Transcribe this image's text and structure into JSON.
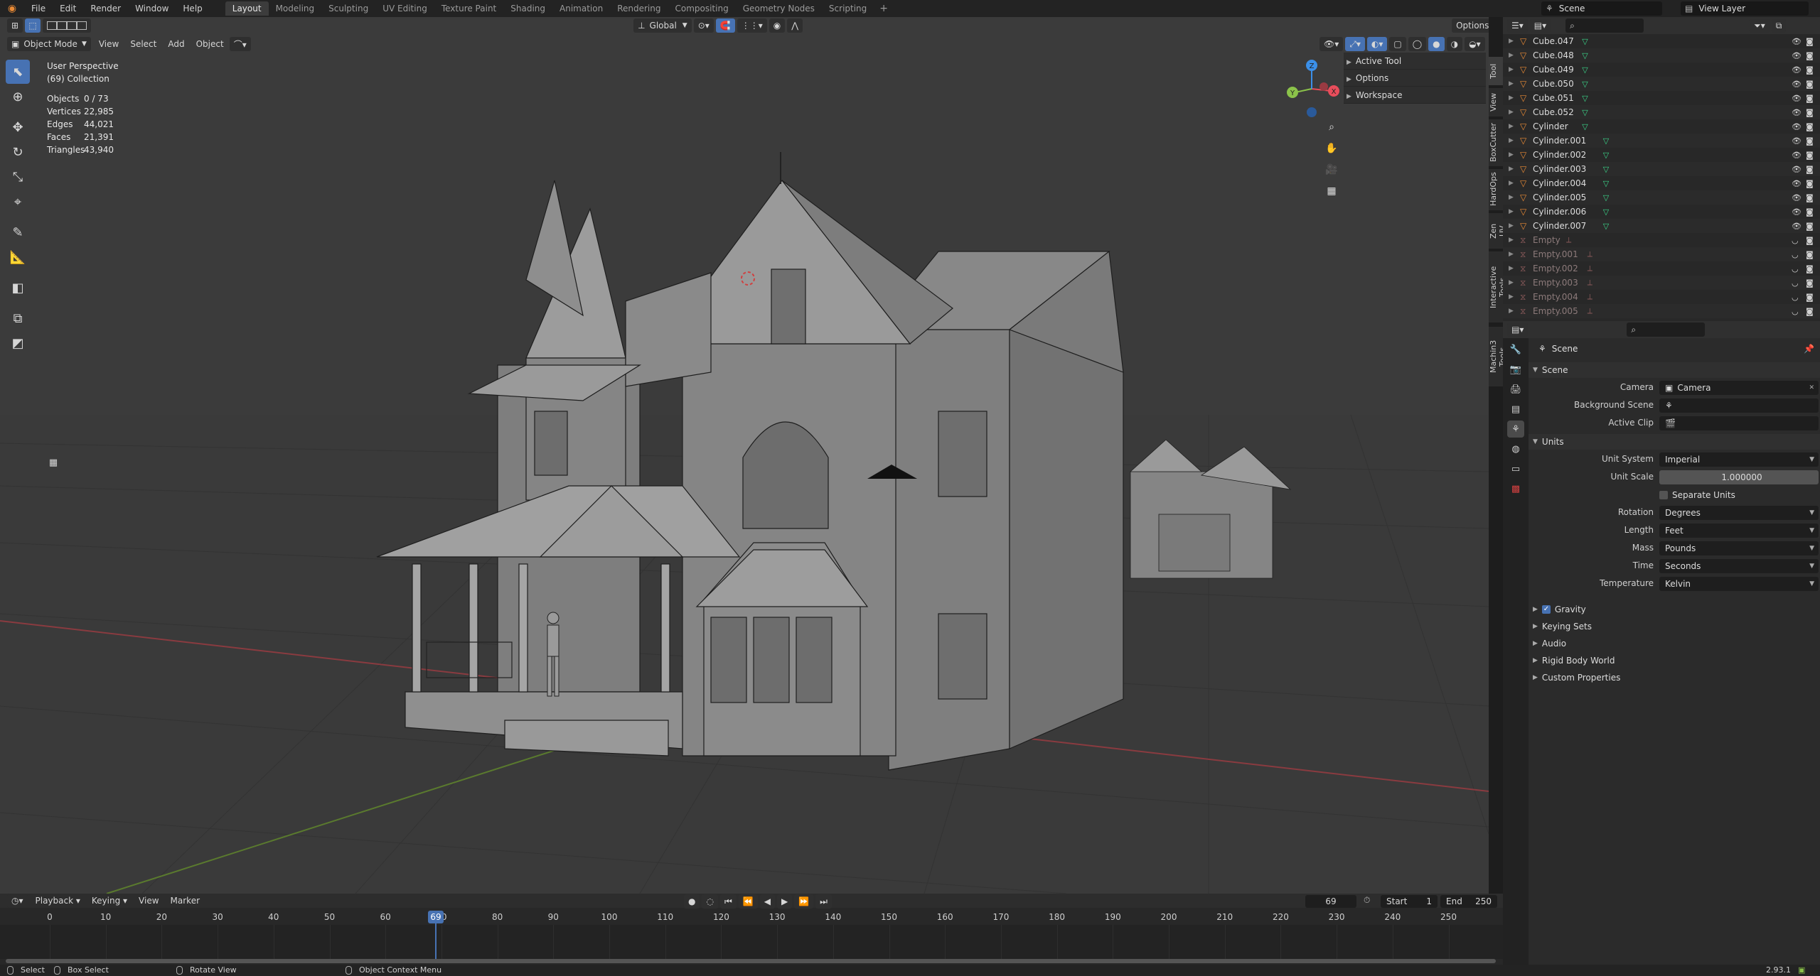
{
  "menubar": {
    "items": [
      "File",
      "Edit",
      "Render",
      "Window",
      "Help"
    ],
    "workspaces": [
      "Layout",
      "Modeling",
      "Sculpting",
      "UV Editing",
      "Texture Paint",
      "Shading",
      "Animation",
      "Rendering",
      "Compositing",
      "Geometry Nodes",
      "Scripting"
    ],
    "active_workspace": "Layout",
    "scene": "Scene",
    "view_layer": "View Layer"
  },
  "viewport_header": {
    "mode": "Object Mode",
    "menus": [
      "View",
      "Select",
      "Add",
      "Object"
    ],
    "transform_orientation": "Global",
    "options_label": "Options"
  },
  "viewport_info": {
    "perspective": "User Perspective",
    "collection": "(69) Collection",
    "stats": [
      {
        "label": "Objects",
        "value": "0 / 73"
      },
      {
        "label": "Vertices",
        "value": "22,985"
      },
      {
        "label": "Edges",
        "value": "44,021"
      },
      {
        "label": "Faces",
        "value": "21,391"
      },
      {
        "label": "Triangles",
        "value": "43,940"
      }
    ]
  },
  "npanel": {
    "items": [
      "Active Tool",
      "Options",
      "Workspace"
    ],
    "tabs": [
      "Tool",
      "View",
      "BoxCutter",
      "HardOps",
      "Zen UV",
      "Interactive Tools",
      "Machin3 Tools"
    ]
  },
  "gizmo": {
    "x": "X",
    "y": "Y",
    "z": "Z"
  },
  "timeline": {
    "menus": [
      "Playback",
      "Keying",
      "View",
      "Marker"
    ],
    "current_frame": "69",
    "start_label": "Start",
    "start": "1",
    "end_label": "End",
    "end": "250",
    "ticks": [
      "0",
      "10",
      "20",
      "30",
      "40",
      "50",
      "60",
      "70",
      "80",
      "90",
      "100",
      "110",
      "120",
      "130",
      "140",
      "150",
      "160",
      "170",
      "180",
      "190",
      "200",
      "210",
      "220",
      "230",
      "240",
      "250"
    ]
  },
  "statusbar": {
    "select": "Select",
    "box_select": "Box Select",
    "rotate_view": "Rotate View",
    "context_menu": "Object Context Menu",
    "version": "2.93.1"
  },
  "outliner": {
    "rows": [
      {
        "name": "Cube.047",
        "type": "mesh"
      },
      {
        "name": "Cube.048",
        "type": "mesh"
      },
      {
        "name": "Cube.049",
        "type": "mesh"
      },
      {
        "name": "Cube.050",
        "type": "mesh"
      },
      {
        "name": "Cube.051",
        "type": "mesh"
      },
      {
        "name": "Cube.052",
        "type": "mesh"
      },
      {
        "name": "Cylinder",
        "type": "mesh"
      },
      {
        "name": "Cylinder.001",
        "type": "mesh"
      },
      {
        "name": "Cylinder.002",
        "type": "mesh"
      },
      {
        "name": "Cylinder.003",
        "type": "mesh"
      },
      {
        "name": "Cylinder.004",
        "type": "mesh"
      },
      {
        "name": "Cylinder.005",
        "type": "mesh"
      },
      {
        "name": "Cylinder.006",
        "type": "mesh"
      },
      {
        "name": "Cylinder.007",
        "type": "mesh"
      },
      {
        "name": "Empty",
        "type": "empty"
      },
      {
        "name": "Empty.001",
        "type": "empty"
      },
      {
        "name": "Empty.002",
        "type": "empty"
      },
      {
        "name": "Empty.003",
        "type": "empty"
      },
      {
        "name": "Empty.004",
        "type": "empty"
      },
      {
        "name": "Empty.005",
        "type": "empty"
      }
    ]
  },
  "properties": {
    "title": "Scene",
    "scene_section": "Scene",
    "camera_label": "Camera",
    "camera_value": "Camera",
    "background_scene_label": "Background Scene",
    "active_clip_label": "Active Clip",
    "units_section": "Units",
    "unit_system_label": "Unit System",
    "unit_system": "Imperial",
    "unit_scale_label": "Unit Scale",
    "unit_scale": "1.000000",
    "separate_units": "Separate Units",
    "rotation_label": "Rotation",
    "rotation": "Degrees",
    "length_label": "Length",
    "length": "Feet",
    "mass_label": "Mass",
    "mass": "Pounds",
    "time_label": "Time",
    "time": "Seconds",
    "temperature_label": "Temperature",
    "temperature": "Kelvin",
    "gravity": "Gravity",
    "collapsed": [
      "Keying Sets",
      "Audio",
      "Rigid Body World",
      "Custom Properties"
    ]
  },
  "colors": {
    "accent": "#4772b3",
    "object_orange": "#e98a35",
    "mesh_green": "#3bd68a",
    "axis_x": "#e84d5b",
    "axis_y": "#8bc34a",
    "axis_z": "#3b8fe8"
  }
}
